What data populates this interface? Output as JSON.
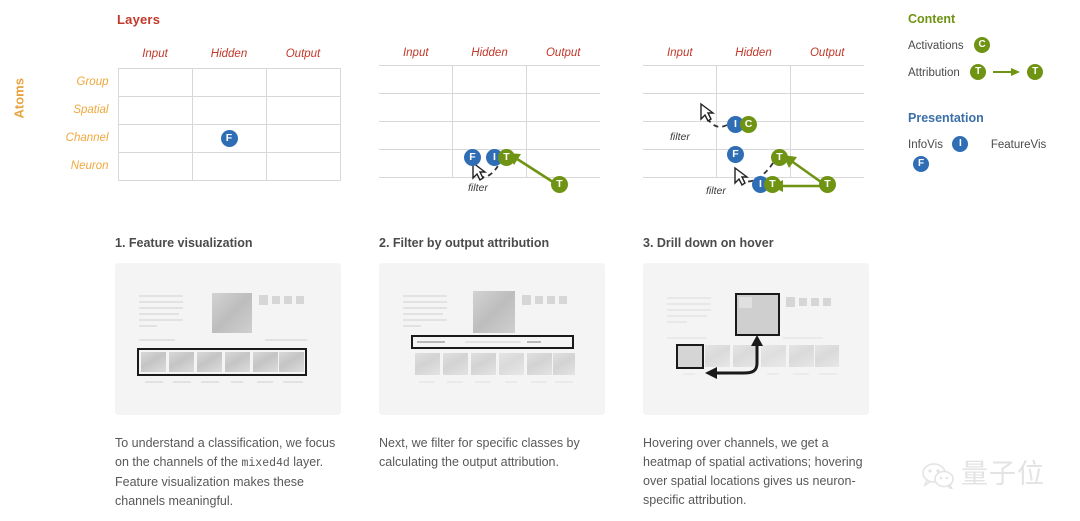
{
  "titles": {
    "layers": "Layers",
    "atoms": "Atoms"
  },
  "grid": {
    "columns": [
      "Input",
      "Hidden",
      "Output"
    ],
    "rows": [
      "Group",
      "Spatial",
      "Channel",
      "Neuron"
    ],
    "filter_label": "filter"
  },
  "diagrams": [
    {
      "id": "diagram-1",
      "badges": [
        {
          "letter": "F",
          "color": "blue",
          "row": "Channel",
          "col": "Hidden"
        }
      ]
    },
    {
      "id": "diagram-2",
      "badges": [
        {
          "letter": "F",
          "color": "blue"
        },
        {
          "letter": "I",
          "color": "blue"
        },
        {
          "letter": "T",
          "color": "green"
        },
        {
          "letter": "T",
          "color": "green"
        }
      ],
      "labels": [
        "filter"
      ]
    },
    {
      "id": "diagram-3",
      "badges": [
        {
          "letter": "I",
          "color": "blue"
        },
        {
          "letter": "C",
          "color": "green"
        },
        {
          "letter": "F",
          "color": "blue"
        },
        {
          "letter": "T",
          "color": "green"
        },
        {
          "letter": "I",
          "color": "blue"
        },
        {
          "letter": "T",
          "color": "green"
        },
        {
          "letter": "T",
          "color": "green"
        }
      ],
      "labels": [
        "filter",
        "filter"
      ]
    }
  ],
  "legend": {
    "content_heading": "Content",
    "presentation_heading": "Presentation",
    "activations_label": "Activations",
    "activations_badge": "C",
    "attribution_label": "Attribution",
    "attribution_badge_from": "T",
    "attribution_badge_to": "T",
    "infovis_label": "InfoVis",
    "infovis_badge": "I",
    "featurevis_label": "FeatureVis",
    "featurevis_badge": "F"
  },
  "panels": [
    {
      "title": "1. Feature visualization",
      "caption_part1": "To understand a classification, we focus on the channels of the ",
      "caption_mono": "mixed4d",
      "caption_part2": " layer. Feature visualization makes these channels meaningful."
    },
    {
      "title": "2. Filter by output attribution",
      "caption_part1": "Next, we filter for specific classes by calculating the output attribution.",
      "caption_mono": "",
      "caption_part2": ""
    },
    {
      "title": "3. Drill down on hover",
      "caption_part1": "Hovering over channels, we get a heatmap of spatial activations; hovering over spatial locations gives us neuron-specific attribution.",
      "caption_mono": "",
      "caption_part2": ""
    }
  ],
  "watermark": {
    "text": "量子位"
  },
  "colors": {
    "blue": "#2f6eb5",
    "green": "#6f9313",
    "red_title": "#c0392b",
    "orange_label": "#f0a83c"
  }
}
